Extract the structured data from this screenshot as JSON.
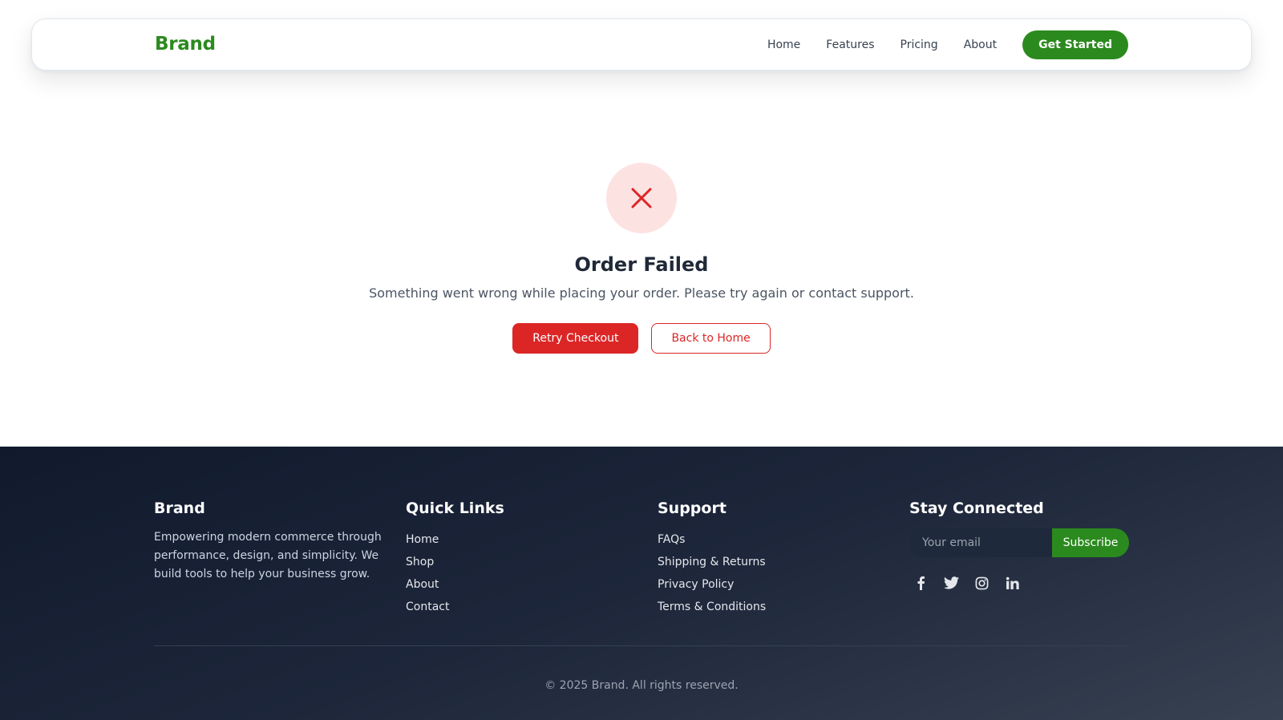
{
  "header": {
    "brand": "Brand",
    "nav": [
      "Home",
      "Features",
      "Pricing",
      "About"
    ],
    "cta": "Get Started"
  },
  "main": {
    "icon": "close-icon",
    "title": "Order Failed",
    "message": "Something went wrong while placing your order. Please try again or contact support.",
    "primary_button": "Retry Checkout",
    "secondary_button": "Back to Home"
  },
  "footer": {
    "brand": {
      "title": "Brand",
      "description": "Empowering modern commerce through performance, design, and simplicity. We build tools to help your business grow."
    },
    "quick_links": {
      "title": "Quick Links",
      "items": [
        "Home",
        "Shop",
        "About",
        "Contact"
      ]
    },
    "support": {
      "title": "Support",
      "items": [
        "FAQs",
        "Shipping & Returns",
        "Privacy Policy",
        "Terms & Conditions"
      ]
    },
    "connect": {
      "title": "Stay Connected",
      "email_placeholder": "Your email",
      "subscribe_label": "Subscribe",
      "socials": [
        "facebook-icon",
        "twitter-icon",
        "instagram-icon",
        "linkedin-icon"
      ]
    },
    "copyright": "© 2025 Brand. All rights reserved."
  },
  "colors": {
    "brand_green": "#2b8a1e",
    "error_red": "#dc2626",
    "error_bg": "#fde2e2",
    "footer_dark": "#111a2d"
  }
}
